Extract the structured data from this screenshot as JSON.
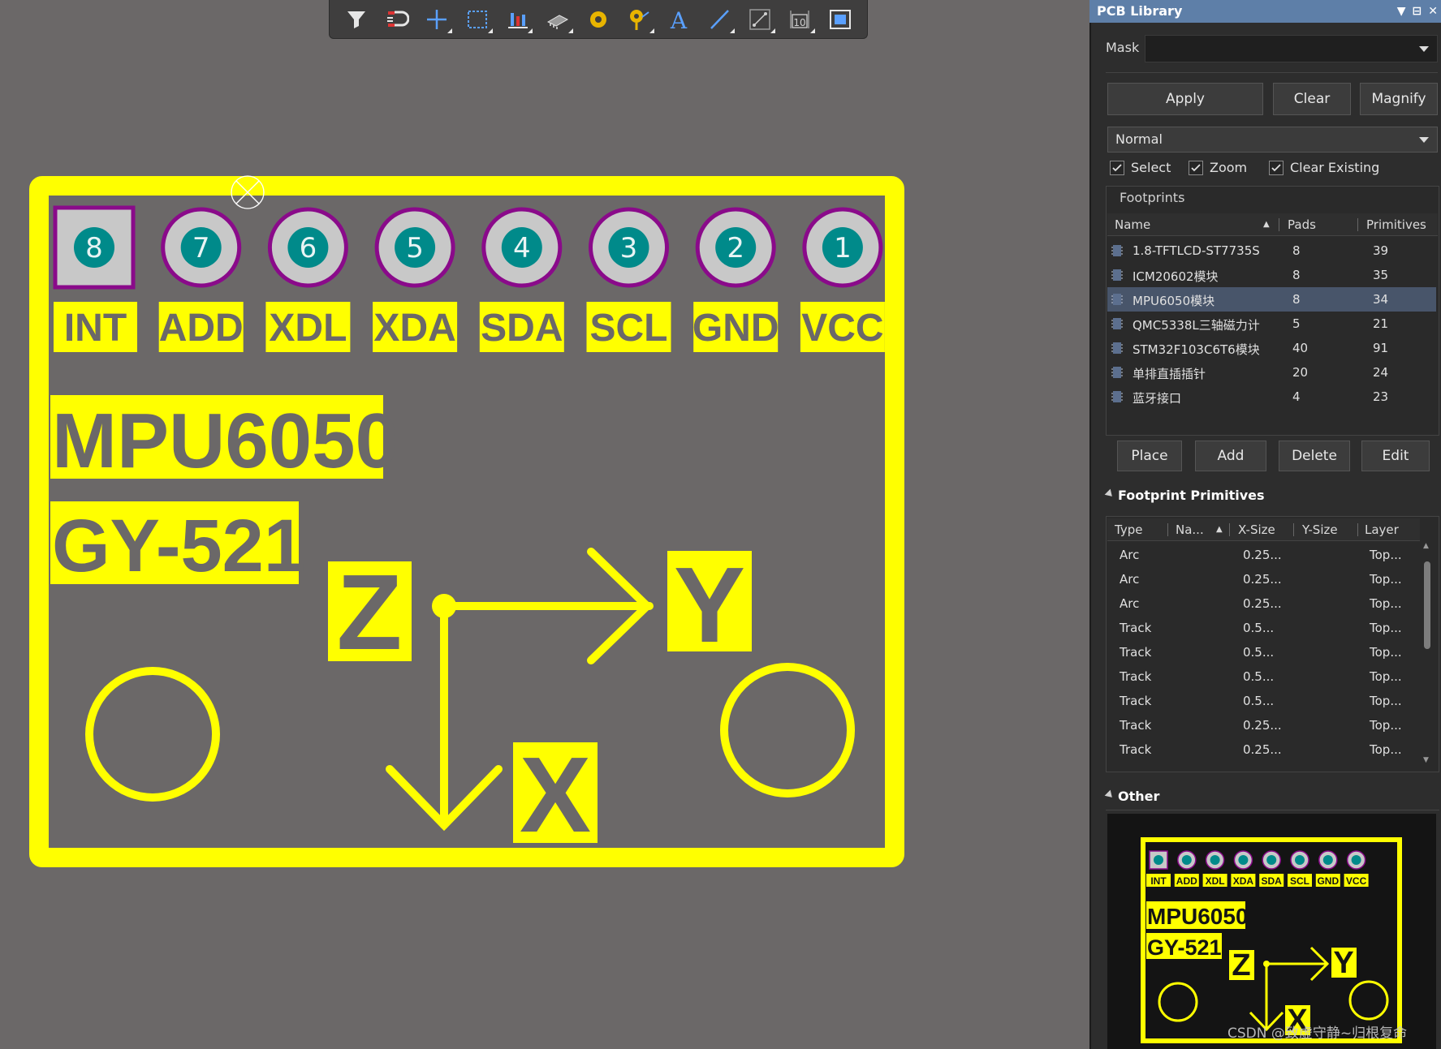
{
  "toolbar": {
    "tools": [
      {
        "icon": "filter-icon"
      },
      {
        "icon": "snap-magnet-icon"
      },
      {
        "icon": "move-cross-icon"
      },
      {
        "icon": "select-rect-icon"
      },
      {
        "icon": "align-icon"
      },
      {
        "icon": "component-icon"
      },
      {
        "icon": "pad-icon"
      },
      {
        "icon": "via-icon"
      },
      {
        "icon": "text-icon"
      },
      {
        "icon": "line-icon"
      },
      {
        "icon": "dimension-icon"
      },
      {
        "icon": "string-10-icon"
      },
      {
        "icon": "region-icon"
      }
    ],
    "string_tool_label": "10"
  },
  "board": {
    "pads": [
      {
        "number": "8",
        "label": "INT",
        "shape": "square"
      },
      {
        "number": "7",
        "label": "ADD",
        "shape": "round"
      },
      {
        "number": "6",
        "label": "XDL",
        "shape": "round"
      },
      {
        "number": "5",
        "label": "XDA",
        "shape": "round"
      },
      {
        "number": "4",
        "label": "SDA",
        "shape": "round"
      },
      {
        "number": "3",
        "label": "SCL",
        "shape": "round"
      },
      {
        "number": "2",
        "label": "GND",
        "shape": "round"
      },
      {
        "number": "1",
        "label": "VCC",
        "shape": "round"
      }
    ],
    "title": "MPU6050",
    "subtitle": "GY-521",
    "axis_z": "Z",
    "axis_y": "Y",
    "axis_x": "X",
    "colors": {
      "silk": "#ffff00",
      "pad_ring": "#8a0a8a",
      "pad_fill": "#c8c8c8",
      "pad_center": "#008a8a",
      "background": "#6b6868"
    }
  },
  "panel": {
    "title": "PCB Library",
    "mask_label": "Mask",
    "mask_value": "",
    "buttons": {
      "apply": "Apply",
      "clear": "Clear",
      "magnify": "Magnify"
    },
    "mode": "Normal",
    "checks": {
      "select": "Select",
      "zoom": "Zoom",
      "clear_existing": "Clear Existing"
    },
    "footprints_title": "Footprints",
    "footprints_columns": {
      "name": "Name",
      "pads": "Pads",
      "primitives": "Primitives"
    },
    "footprints": [
      {
        "name": "1.8-TFTLCD-ST7735S",
        "pads": "8",
        "primitives": "39"
      },
      {
        "name": "ICM20602模块",
        "pads": "8",
        "primitives": "35"
      },
      {
        "name": "MPU6050模块",
        "pads": "8",
        "primitives": "34"
      },
      {
        "name": "QMC5338L三轴磁力计",
        "pads": "5",
        "primitives": "21"
      },
      {
        "name": "STM32F103C6T6模块",
        "pads": "40",
        "primitives": "91"
      },
      {
        "name": "单排直插插针",
        "pads": "20",
        "primitives": "24"
      },
      {
        "name": "蓝牙接口",
        "pads": "4",
        "primitives": "23"
      }
    ],
    "selected_footprint": "MPU6050模块",
    "fp_buttons": {
      "place": "Place",
      "add": "Add",
      "delete": "Delete",
      "edit": "Edit"
    },
    "primitives_title": "Footprint Primitives",
    "primitives_columns": {
      "type": "Type",
      "name": "Na...",
      "xsize": "X-Size",
      "ysize": "Y-Size",
      "layer": "Layer"
    },
    "primitives": [
      {
        "type": "Arc",
        "xsize": "0.25...",
        "layer": "Top..."
      },
      {
        "type": "Arc",
        "xsize": "0.25...",
        "layer": "Top..."
      },
      {
        "type": "Arc",
        "xsize": "0.25...",
        "layer": "Top..."
      },
      {
        "type": "Track",
        "xsize": "0.5...",
        "layer": "Top..."
      },
      {
        "type": "Track",
        "xsize": "0.5...",
        "layer": "Top..."
      },
      {
        "type": "Track",
        "xsize": "0.5...",
        "layer": "Top..."
      },
      {
        "type": "Track",
        "xsize": "0.5...",
        "layer": "Top..."
      },
      {
        "type": "Track",
        "xsize": "0.25...",
        "layer": "Top..."
      },
      {
        "type": "Track",
        "xsize": "0.25...",
        "layer": "Top..."
      }
    ],
    "other_title": "Other",
    "watermark": "CSDN @致虚守静~归根复命"
  }
}
